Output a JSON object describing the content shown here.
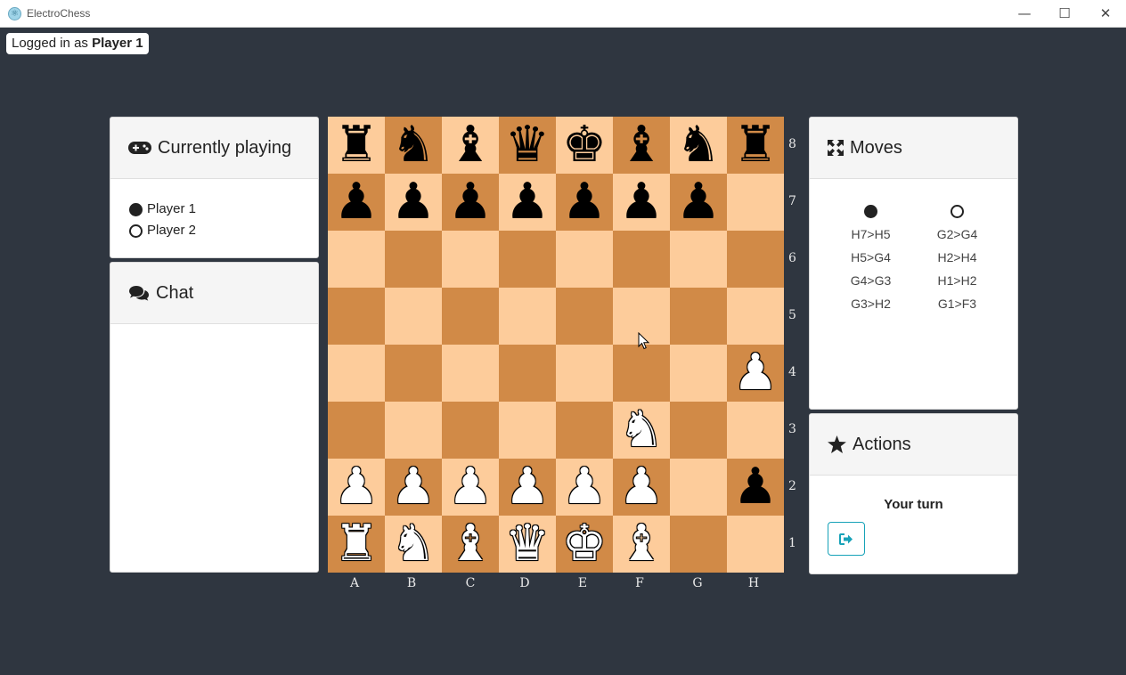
{
  "window": {
    "title": "ElectroChess",
    "icon": "electron-atom-icon",
    "minimize": "—",
    "maximize": "☐",
    "close": "✕"
  },
  "login": {
    "prefix": "Logged in as",
    "user": "Player 1"
  },
  "playing": {
    "title": "Currently playing",
    "icon": "gamepad-icon",
    "players": [
      {
        "name": "Player 1",
        "color": "black"
      },
      {
        "name": "Player 2",
        "color": "white"
      }
    ]
  },
  "chat": {
    "title": "Chat",
    "icon": "comments-icon"
  },
  "moves": {
    "title": "Moves",
    "icon": "arrows-expand-icon",
    "black": [
      "H7>H5",
      "H5>G4",
      "G4>G3",
      "G3>H2"
    ],
    "white": [
      "G2>G4",
      "H2>H4",
      "H1>H2",
      "G1>F3"
    ]
  },
  "actions": {
    "title": "Actions",
    "icon": "star-icon",
    "status": "Your turn",
    "button_icon": "sign-out-icon",
    "accent": "#17a2b8"
  },
  "board": {
    "files": [
      "A",
      "B",
      "C",
      "D",
      "E",
      "F",
      "G",
      "H"
    ],
    "ranks": [
      "8",
      "7",
      "6",
      "5",
      "4",
      "3",
      "2",
      "1"
    ],
    "light_color": "#fdcc9b",
    "dark_color": "#d18a47",
    "position": [
      [
        "bR",
        "bN",
        "bB",
        "bQ",
        "bK",
        "bB",
        "bN",
        "bR"
      ],
      [
        "bP",
        "bP",
        "bP",
        "bP",
        "bP",
        "bP",
        "bP",
        ""
      ],
      [
        "",
        "",
        "",
        "",
        "",
        "",
        "",
        ""
      ],
      [
        "",
        "",
        "",
        "",
        "",
        "",
        "",
        ""
      ],
      [
        "",
        "",
        "",
        "",
        "",
        "",
        "",
        "wP"
      ],
      [
        "",
        "",
        "",
        "",
        "",
        "wN",
        "",
        ""
      ],
      [
        "wP",
        "wP",
        "wP",
        "wP",
        "wP",
        "wP",
        "",
        "bP"
      ],
      [
        "wR",
        "wN",
        "wB",
        "wQ",
        "wK",
        "wB",
        "",
        ""
      ]
    ]
  }
}
